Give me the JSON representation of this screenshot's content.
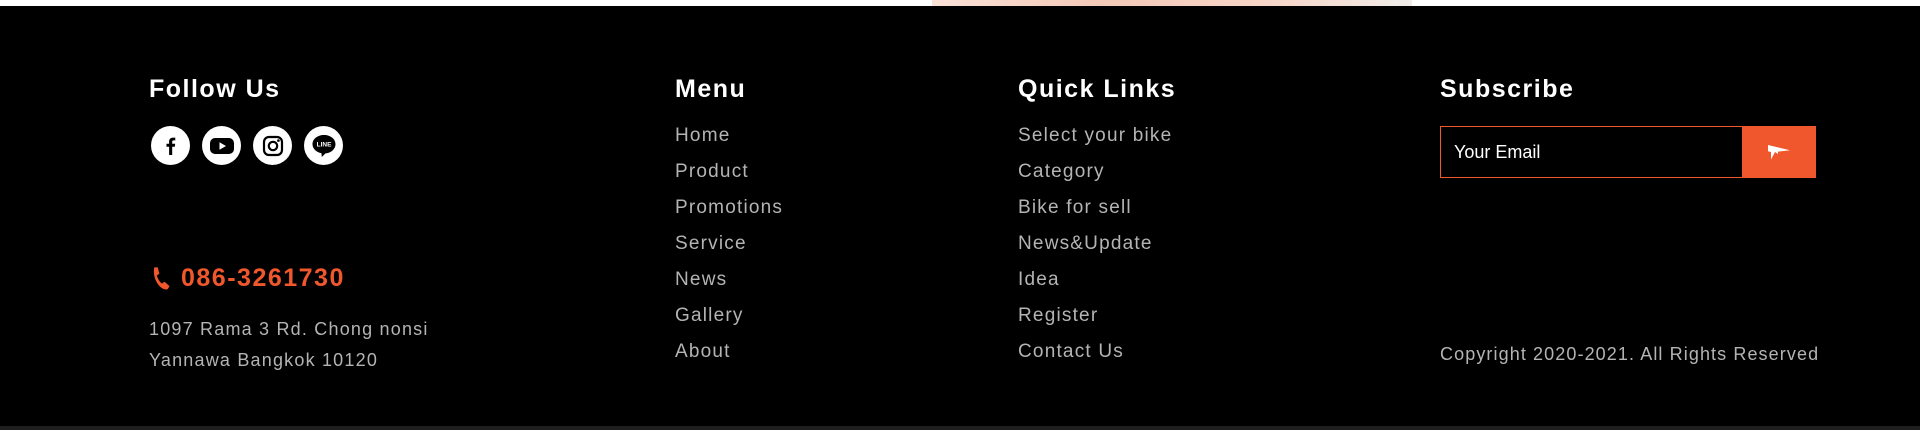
{
  "colors": {
    "accent": "#f0572c",
    "background": "#000000",
    "heading": "#ffffff",
    "text_muted": "#b4b4b4"
  },
  "follow": {
    "heading": "Follow Us",
    "social": [
      {
        "icon": "facebook-icon"
      },
      {
        "icon": "youtube-icon"
      },
      {
        "icon": "instagram-icon"
      },
      {
        "icon": "line-icon",
        "text": "LINE"
      }
    ],
    "phone_icon": "phone-icon",
    "phone": "086-3261730",
    "address_line1": "1097 Rama 3 Rd. Chong nonsi",
    "address_line2": "Yannawa Bangkok 10120"
  },
  "menu": {
    "heading": "Menu",
    "items": [
      "Home",
      "Product",
      "Promotions",
      "Service",
      "News",
      "Gallery",
      "About"
    ]
  },
  "quick": {
    "heading": "Quick Links",
    "items": [
      "Select your bike",
      "Category",
      "Bike for sell",
      "News&Update",
      "Idea",
      "Register",
      "Contact Us"
    ]
  },
  "subscribe": {
    "heading": "Subscribe",
    "placeholder": "Your Email",
    "button_icon": "send-icon",
    "copyright": "Copyright 2020-2021. All Rights Reserved"
  }
}
